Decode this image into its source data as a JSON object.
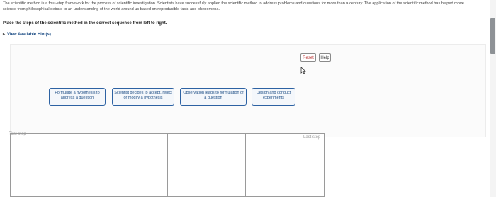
{
  "intro": "The scientific method is a four-step framework for the process of scientific investigation. Scientists have successfully applied the scientific method to address problems and questions for more than a century. The application of the scientific method has helped move science from philosophical debate to an understanding of the world around us based on reproducible facts and phenomena.",
  "instruction": "Place the steps of the scientific method in the correct sequence from left to right.",
  "hints_label": "View Available Hint(s)",
  "buttons": {
    "reset": "Reset",
    "help": "Help"
  },
  "cards": [
    "Formulate a hypothesis to address a question",
    "Scientist decides to accept, reject or modify a hypothesis",
    "Observation leads to formulation of a question",
    "Design and conduct experiments"
  ],
  "slots": {
    "first_label": "First step",
    "last_label": "Last step"
  }
}
